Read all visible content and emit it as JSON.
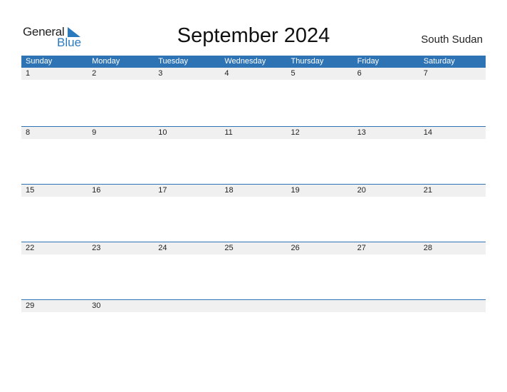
{
  "logo": {
    "general": "General",
    "blue": "Blue"
  },
  "title": "September 2024",
  "country": "South Sudan",
  "colors": {
    "accent": "#2e74b5",
    "date_strip": "#f0f0f0"
  },
  "weekdays": [
    "Sunday",
    "Monday",
    "Tuesday",
    "Wednesday",
    "Thursday",
    "Friday",
    "Saturday"
  ],
  "weeks": [
    [
      "1",
      "2",
      "3",
      "4",
      "5",
      "6",
      "7"
    ],
    [
      "8",
      "9",
      "10",
      "11",
      "12",
      "13",
      "14"
    ],
    [
      "15",
      "16",
      "17",
      "18",
      "19",
      "20",
      "21"
    ],
    [
      "22",
      "23",
      "24",
      "25",
      "26",
      "27",
      "28"
    ],
    [
      "29",
      "30",
      "",
      "",
      "",
      "",
      ""
    ]
  ]
}
